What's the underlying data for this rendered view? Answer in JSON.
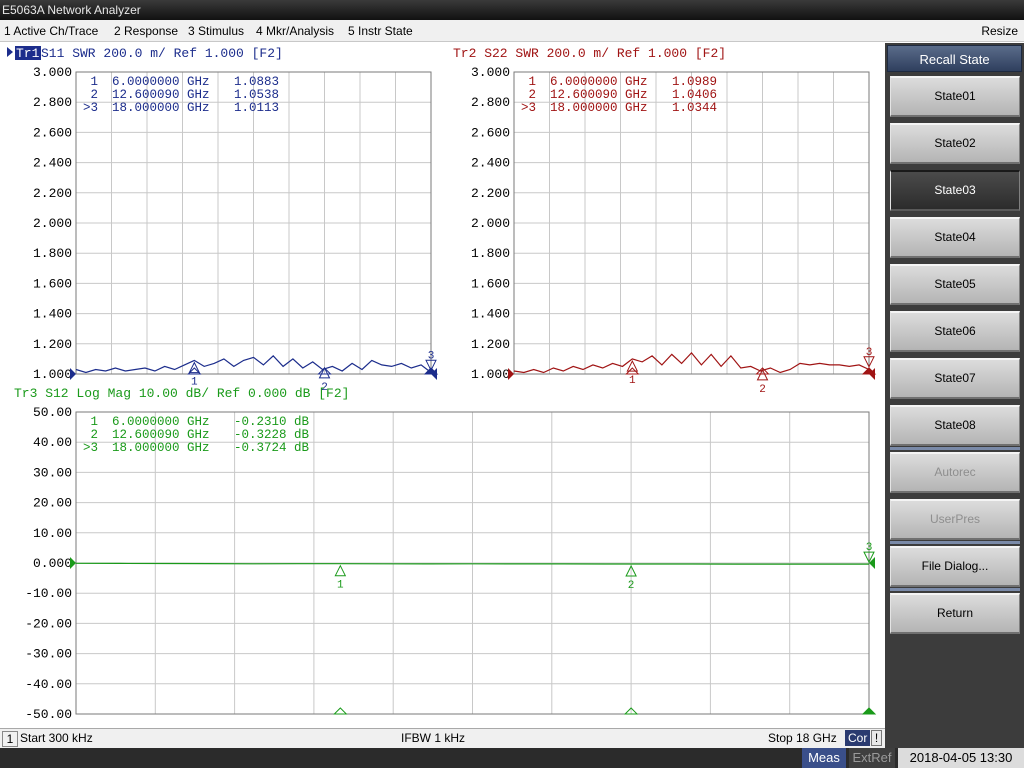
{
  "window": {
    "title": "E5063A Network Analyzer"
  },
  "menu": {
    "items": [
      "1 Active Ch/Trace",
      "2 Response",
      "3 Stimulus",
      "4 Mkr/Analysis",
      "5 Instr State"
    ],
    "resize": "Resize"
  },
  "colors": {
    "tr1": "#1c2d8c",
    "tr2": "#a01414",
    "tr3": "#1a9a1a",
    "grid": "#c8c8c8"
  },
  "traces": [
    {
      "id": "tr1",
      "label_badge": "Tr1",
      "label_text": " S11  SWR 200.0 m/ Ref 1.000  [F2]",
      "color": "#1c2d8c",
      "y_ticks": [
        "3.000",
        "2.800",
        "2.600",
        "2.400",
        "2.200",
        "2.000",
        "1.800",
        "1.600",
        "1.400",
        "1.200",
        "1.000"
      ],
      "markers": [
        {
          "idx": "1",
          "freq": "6.0000000 GHz",
          "val": "1.0883"
        },
        {
          "idx": "2",
          "freq": "12.600090 GHz",
          "val": "1.0538"
        },
        {
          "idx": ">3",
          "freq": "18.000000 GHz",
          "val": "1.0113"
        }
      ]
    },
    {
      "id": "tr2",
      "label_badge": "",
      "label_text": "Tr2 S22 SWR 200.0 m/ Ref 1.000  [F2]",
      "color": "#a01414",
      "y_ticks": [
        "3.000",
        "2.800",
        "2.600",
        "2.400",
        "2.200",
        "2.000",
        "1.800",
        "1.600",
        "1.400",
        "1.200",
        "1.000"
      ],
      "markers": [
        {
          "idx": "1",
          "freq": "6.0000000 GHz",
          "val": "1.0989"
        },
        {
          "idx": "2",
          "freq": "12.600090 GHz",
          "val": "1.0406"
        },
        {
          "idx": ">3",
          "freq": "18.000000 GHz",
          "val": "1.0344"
        }
      ]
    },
    {
      "id": "tr3",
      "label_badge": "",
      "label_text": "Tr3 S12 Log Mag 10.00 dB/ Ref 0.000 dB [F2]",
      "color": "#1a9a1a",
      "y_ticks": [
        "50.00",
        "40.00",
        "30.00",
        "20.00",
        "10.00",
        "0.000",
        "-10.00",
        "-20.00",
        "-30.00",
        "-40.00",
        "-50.00"
      ],
      "markers": [
        {
          "idx": "1",
          "freq": "6.0000000 GHz",
          "val": "-0.2310 dB"
        },
        {
          "idx": "2",
          "freq": "12.600090 GHz",
          "val": "-0.3228 dB"
        },
        {
          "idx": ">3",
          "freq": "18.000000 GHz",
          "val": "-0.3724 dB"
        }
      ]
    }
  ],
  "chart_data": [
    {
      "type": "line",
      "title": "Tr1 S11 SWR 200.0 m/ Ref 1.000 [F2]",
      "x_range_ghz": [
        0.0003,
        18
      ],
      "ylim": [
        1.0,
        3.0
      ],
      "series": [
        {
          "name": "S11",
          "x": [
            0,
            0.5,
            1,
            1.5,
            2,
            2.5,
            3,
            3.5,
            4,
            4.5,
            5,
            5.5,
            6,
            6.5,
            7,
            7.5,
            8,
            8.5,
            9,
            9.5,
            10,
            10.5,
            11,
            11.5,
            12,
            12.5,
            13,
            13.5,
            14,
            14.5,
            15,
            15.5,
            16,
            16.5,
            17,
            17.5,
            18
          ],
          "y": [
            1.03,
            1.01,
            1.03,
            1.02,
            1.04,
            1.02,
            1.03,
            1.04,
            1.02,
            1.05,
            1.03,
            1.06,
            1.09,
            1.05,
            1.07,
            1.1,
            1.05,
            1.09,
            1.11,
            1.06,
            1.12,
            1.05,
            1.1,
            1.04,
            1.08,
            1.03,
            1.05,
            1.02,
            1.07,
            1.03,
            1.09,
            1.06,
            1.05,
            1.07,
            1.04,
            1.06,
            1.01
          ]
        }
      ],
      "markers": [
        {
          "x": 6.0,
          "y": 1.0883
        },
        {
          "x": 12.60009,
          "y": 1.0538
        },
        {
          "x": 18.0,
          "y": 1.0113
        }
      ]
    },
    {
      "type": "line",
      "title": "Tr2 S22 SWR 200.0 m/ Ref 1.000 [F2]",
      "x_range_ghz": [
        0.0003,
        18
      ],
      "ylim": [
        1.0,
        3.0
      ],
      "series": [
        {
          "name": "S22",
          "x": [
            0,
            0.5,
            1,
            1.5,
            2,
            2.5,
            3,
            3.5,
            4,
            4.5,
            5,
            5.5,
            6,
            6.5,
            7,
            7.5,
            8,
            8.5,
            9,
            9.5,
            10,
            10.5,
            11,
            11.5,
            12,
            12.5,
            13,
            13.5,
            14,
            14.5,
            15,
            15.5,
            16,
            16.5,
            17,
            17.5,
            18
          ],
          "y": [
            1.02,
            1.01,
            1.03,
            1.01,
            1.04,
            1.02,
            1.05,
            1.03,
            1.06,
            1.04,
            1.07,
            1.05,
            1.1,
            1.08,
            1.12,
            1.06,
            1.13,
            1.07,
            1.14,
            1.06,
            1.13,
            1.05,
            1.12,
            1.04,
            1.05,
            1.02,
            1.04,
            1.01,
            1.03,
            1.07,
            1.06,
            1.07,
            1.06,
            1.06,
            1.05,
            1.06,
            1.03
          ]
        }
      ],
      "markers": [
        {
          "x": 6.0,
          "y": 1.0989
        },
        {
          "x": 12.60009,
          "y": 1.0406
        },
        {
          "x": 18.0,
          "y": 1.0344
        }
      ]
    },
    {
      "type": "line",
      "title": "Tr3 S12 Log Mag 10.00 dB/ Ref 0.000 dB [F2]",
      "x_range_ghz": [
        0.0003,
        18
      ],
      "ylim": [
        -50,
        50
      ],
      "series": [
        {
          "name": "S12",
          "x": [
            0,
            1,
            2,
            3,
            4,
            5,
            6,
            7,
            8,
            9,
            10,
            11,
            12,
            13,
            14,
            15,
            16,
            17,
            18
          ],
          "y": [
            -0.1,
            -0.12,
            -0.15,
            -0.2,
            -0.25,
            -0.22,
            -0.23,
            -0.27,
            -0.3,
            -0.28,
            -0.3,
            -0.31,
            -0.32,
            -0.33,
            -0.34,
            -0.35,
            -0.36,
            -0.36,
            -0.37
          ]
        }
      ],
      "markers": [
        {
          "x": 6.0,
          "y": -0.231
        },
        {
          "x": 12.60009,
          "y": -0.3228
        },
        {
          "x": 18.0,
          "y": -0.3724
        }
      ]
    }
  ],
  "softkeys": {
    "title": "Recall State",
    "buttons": [
      {
        "label": "State01",
        "state": "normal"
      },
      {
        "label": "State02",
        "state": "normal"
      },
      {
        "label": "State03",
        "state": "selected"
      },
      {
        "label": "State04",
        "state": "normal"
      },
      {
        "label": "State05",
        "state": "normal"
      },
      {
        "label": "State06",
        "state": "normal"
      },
      {
        "label": "State07",
        "state": "normal"
      },
      {
        "label": "State08",
        "state": "normal"
      },
      {
        "label": "Autorec",
        "state": "disabled"
      },
      {
        "label": "UserPres",
        "state": "disabled"
      },
      {
        "label": "File Dialog...",
        "state": "normal"
      },
      {
        "label": "Return",
        "state": "normal"
      }
    ]
  },
  "status": {
    "channel": "1",
    "start": "Start 300 kHz",
    "ifbw": "IFBW 1 kHz",
    "stop": "Stop 18 GHz",
    "cor": "Cor",
    "excl": "!"
  },
  "bottom": {
    "meas": "Meas",
    "extref": "ExtRef",
    "datetime": "2018-04-05 13:30"
  }
}
